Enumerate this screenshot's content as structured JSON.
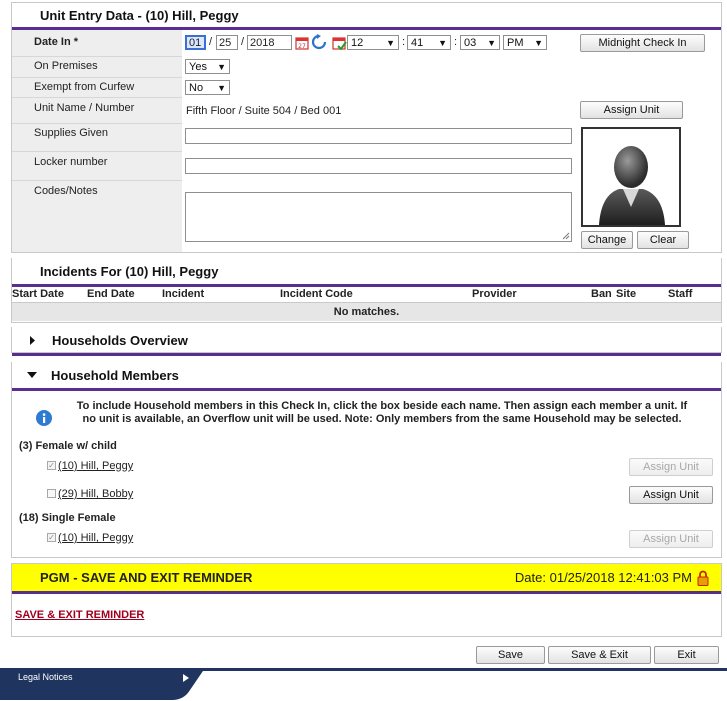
{
  "unit_entry": {
    "title": "Unit Entry Data - (10) Hill, Peggy",
    "date_in_label": "Date In *",
    "date_month": "01",
    "date_day": "25",
    "date_year": "2018",
    "time_hour": "12",
    "time_minute": "41",
    "time_second": "03",
    "time_ampm": "PM",
    "midnight_button": "Midnight Check In",
    "on_premises_label": "On Premises",
    "on_premises_value": "Yes",
    "exempt_label": "Exempt from Curfew",
    "exempt_value": "No",
    "unit_label": "Unit Name / Number",
    "unit_value": "Fifth Floor / Suite 504 / Bed 001",
    "assign_unit_button": "Assign Unit",
    "supplies_label": "Supplies Given",
    "locker_label": "Locker number",
    "codes_label": "Codes/Notes",
    "change_button": "Change",
    "clear_button": "Clear"
  },
  "incidents": {
    "title": "Incidents For (10) Hill, Peggy",
    "columns": [
      "Start Date",
      "End Date",
      "Incident",
      "Incident Code",
      "Provider",
      "Ban",
      "Site",
      "Staff"
    ],
    "empty_text": "No matches."
  },
  "households_overview": {
    "title": "Households Overview"
  },
  "household_members": {
    "title": "Household Members",
    "info_text": "To include Household members in this Check In, click the box beside each name. Then assign each member a unit. If no unit is available, an Overflow unit will be used. Note: Only members from the same Household may be selected.",
    "groups": [
      {
        "name": "(3) Female w/ child",
        "members": [
          {
            "name": "(10) Hill, Peggy",
            "checked": true,
            "button": "Assign Unit",
            "enabled": false
          },
          {
            "name": "(29) Hill, Bobby",
            "checked": false,
            "button": "Assign Unit",
            "enabled": true
          }
        ]
      },
      {
        "name": "(18) Single Female",
        "members": [
          {
            "name": "(10) Hill, Peggy",
            "checked": true,
            "button": "Assign Unit",
            "enabled": false
          }
        ]
      }
    ]
  },
  "reminder": {
    "title": "PGM - SAVE AND EXIT REMINDER",
    "date_text": "Date: 01/25/2018 12:41:03 PM",
    "link_text": "SAVE & EXIT REMINDER"
  },
  "footer": {
    "save": "Save",
    "save_exit": "Save & Exit",
    "exit": "Exit",
    "legal": "Legal Notices"
  },
  "colors": {
    "accent": "#5a2d91",
    "reminder_bg": "#ffff00",
    "link": "#a0001e",
    "footer_bar": "#1f3560"
  }
}
